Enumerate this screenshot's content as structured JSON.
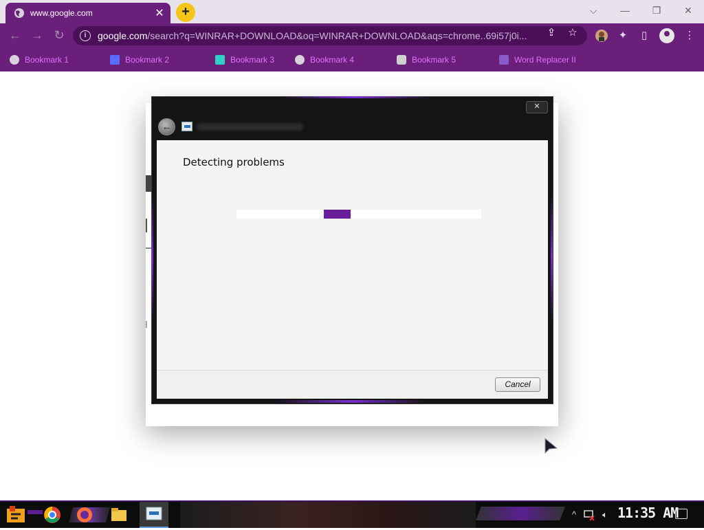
{
  "browser": {
    "tab_title": "www.google.com",
    "tab_close": "✕",
    "new_tab": "+",
    "window_controls": {
      "list": "⌵",
      "minimize": "—",
      "restore": "❐",
      "close": "✕"
    },
    "url_host": "google.com",
    "url_rest": "/search?q=WINRAR+DOWNLOAD&oq=WINRAR+DOWNLOAD&aqs=chrome..69i57j0i...",
    "bookmarks": [
      {
        "label": "Bookmark 1",
        "icon": "globe-icon"
      },
      {
        "label": "Bookmark 2",
        "icon": "bookmark-icon"
      },
      {
        "label": "Bookmark 3",
        "icon": "bookmark-icon"
      },
      {
        "label": "Bookmark 4",
        "icon": "globe-icon"
      },
      {
        "label": "Bookmark 5",
        "icon": "bookmark-icon"
      },
      {
        "label": "Word Replacer II",
        "icon": "wr-extension-icon"
      }
    ]
  },
  "dialog": {
    "close_label": "✕",
    "heading": "Detecting problems",
    "progress_percent": 40,
    "cancel_label": "Cancel"
  },
  "taskbar": {
    "clock": "11:35 AM",
    "tray_chevron": "^"
  },
  "colors": {
    "browser_accent": "#6a1f7a",
    "bookmark_text": "#e070ff",
    "progress_fill": "#6a1f9a",
    "dialog_frame": "#141414"
  }
}
